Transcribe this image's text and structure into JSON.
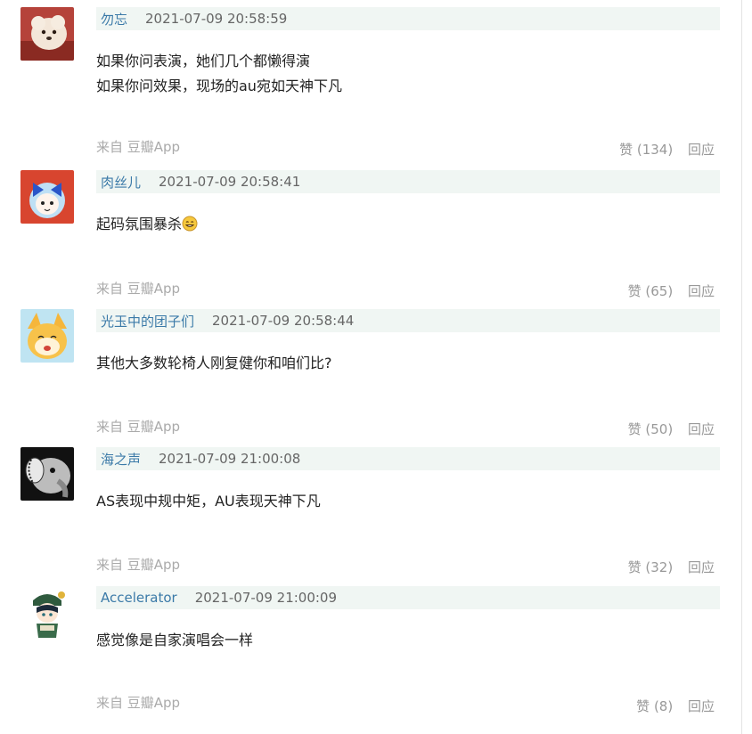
{
  "comments": [
    {
      "author": "勿忘",
      "time": "2021-07-09 20:58:59",
      "lines": [
        "如果你问表演，她们几个都懒得演",
        "如果你问效果，现场的au宛如天神下凡"
      ],
      "source": "来自 豆瓣App",
      "likes": "赞 (134)",
      "reply": "回应"
    },
    {
      "author": "肉丝儿",
      "time": "2021-07-09 20:58:41",
      "lines": [
        "起码氛围暴杀"
      ],
      "source": "来自 豆瓣App",
      "likes": "赞 (65)",
      "reply": "回应"
    },
    {
      "author": "光玉中的团子们",
      "time": "2021-07-09 20:58:44",
      "lines": [
        "其他大多数轮椅人刚复健你和咱们比?"
      ],
      "source": "来自 豆瓣App",
      "likes": "赞 (50)",
      "reply": "回应"
    },
    {
      "author": "海之声",
      "time": "2021-07-09 21:00:08",
      "lines": [
        "AS表现中规中矩，AU表现天神下凡"
      ],
      "source": "来自 豆瓣App",
      "likes": "赞 (32)",
      "reply": "回应"
    },
    {
      "author": "Accelerator",
      "time": "2021-07-09 21:00:09",
      "lines": [
        "感觉像是自家演唱会一样"
      ],
      "source": "来自 豆瓣App",
      "likes": "赞 (8)",
      "reply": "回应"
    }
  ]
}
